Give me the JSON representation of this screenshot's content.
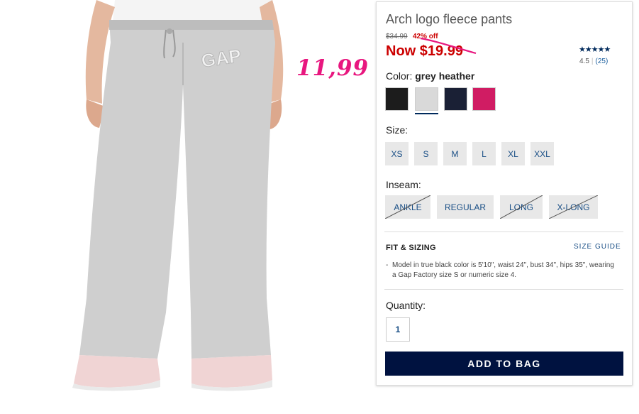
{
  "annotation": {
    "handwritten_price": "11,99",
    "color": "#e8177f"
  },
  "product": {
    "title": "Arch logo fleece pants",
    "was_price": "$34.99",
    "discount": "42% off",
    "now_price": "Now $19.99",
    "image_icon": "product-photo-grey-fleece-pants"
  },
  "rating": {
    "stars_glyph": "★★★★★",
    "value": "4.5",
    "count": "(25)",
    "color": "#002a5c"
  },
  "color": {
    "label": "Color:",
    "selected": "grey heather",
    "swatches": [
      {
        "name": "black",
        "hex": "#1c1c1c"
      },
      {
        "name": "grey heather",
        "hex": "#d9d9d9",
        "selected": true
      },
      {
        "name": "navy",
        "hex": "#1a2035"
      },
      {
        "name": "pink",
        "hex": "#d01c63"
      }
    ]
  },
  "size": {
    "label": "Size:",
    "options": [
      "XS",
      "S",
      "M",
      "L",
      "XL",
      "XXL"
    ]
  },
  "inseam": {
    "label": "Inseam:",
    "options": [
      {
        "label": "ANKLE",
        "unavailable": true
      },
      {
        "label": "REGULAR",
        "unavailable": false
      },
      {
        "label": "LONG",
        "unavailable": true
      },
      {
        "label": "X-LONG",
        "unavailable": true
      }
    ]
  },
  "fit": {
    "title": "FIT & SIZING",
    "size_guide": "SIZE GUIDE",
    "dash": "-",
    "note": "Model in true black color is 5'10\", waist 24\", bust 34\", hips 35\", wearing a Gap Factory size S or numeric size 4."
  },
  "quantity": {
    "label": "Quantity:",
    "value": "1"
  },
  "cart": {
    "button_label": "ADD TO BAG",
    "color": "#001240"
  },
  "image": {
    "logo_text": "GAP"
  }
}
